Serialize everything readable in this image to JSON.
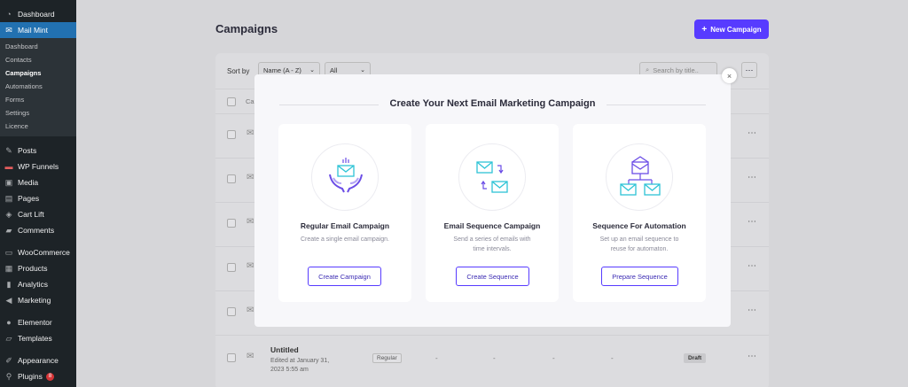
{
  "sidebar": {
    "dashboard": "Dashboard",
    "mailmint": "Mail Mint",
    "sub": [
      "Dashboard",
      "Contacts",
      "Campaigns",
      "Automations",
      "Forms",
      "Settings",
      "Licence"
    ],
    "items": [
      {
        "label": "Posts",
        "icon": "pin-icon"
      },
      {
        "label": "WP Funnels",
        "icon": "funnel-icon"
      },
      {
        "label": "Media",
        "icon": "media-icon"
      },
      {
        "label": "Pages",
        "icon": "pages-icon"
      },
      {
        "label": "Cart Lift",
        "icon": "cart-icon"
      },
      {
        "label": "Comments",
        "icon": "comment-icon"
      },
      {
        "label": "WooCommerce",
        "icon": "woo-icon"
      },
      {
        "label": "Products",
        "icon": "products-icon"
      },
      {
        "label": "Analytics",
        "icon": "analytics-icon"
      },
      {
        "label": "Marketing",
        "icon": "megaphone-icon"
      },
      {
        "label": "Elementor",
        "icon": "elementor-icon"
      },
      {
        "label": "Templates",
        "icon": "folder-icon"
      },
      {
        "label": "Appearance",
        "icon": "brush-icon"
      },
      {
        "label": "Plugins",
        "icon": "plugin-icon"
      }
    ],
    "plugins_badge": "8"
  },
  "page": {
    "title": "Campaigns",
    "new_button": "New Campaign",
    "sort_by": "Sort by",
    "sort_value": "Name (A - Z)",
    "filter_value": "All",
    "search_placeholder": "Search by title..",
    "column_hint": "Ca"
  },
  "rows": {
    "last_title": "Untitled",
    "last_sub": "Edited at January 31, 2023 5:55 am",
    "last_tag": "Regular",
    "last_status": "Draft",
    "dash": "-"
  },
  "modal": {
    "title": "Create Your Next Email Marketing Campaign",
    "options": [
      {
        "title": "Regular Email Campaign",
        "desc": "Create a single email campaign.",
        "button": "Create Campaign"
      },
      {
        "title": "Email Sequence Campaign",
        "desc": "Send a series of emails with time intervals.",
        "button": "Create Sequence"
      },
      {
        "title": "Sequence For Automation",
        "desc": "Set up an email sequence to reuse for automaton.",
        "button": "Prepare Sequence"
      }
    ],
    "close": "×"
  },
  "colors": {
    "accent": "#573bff",
    "wp_sidebar": "#1d2327",
    "wp_active": "#2271b1",
    "icon_teal": "#2ec4d6",
    "icon_purple": "#6b4de6"
  }
}
